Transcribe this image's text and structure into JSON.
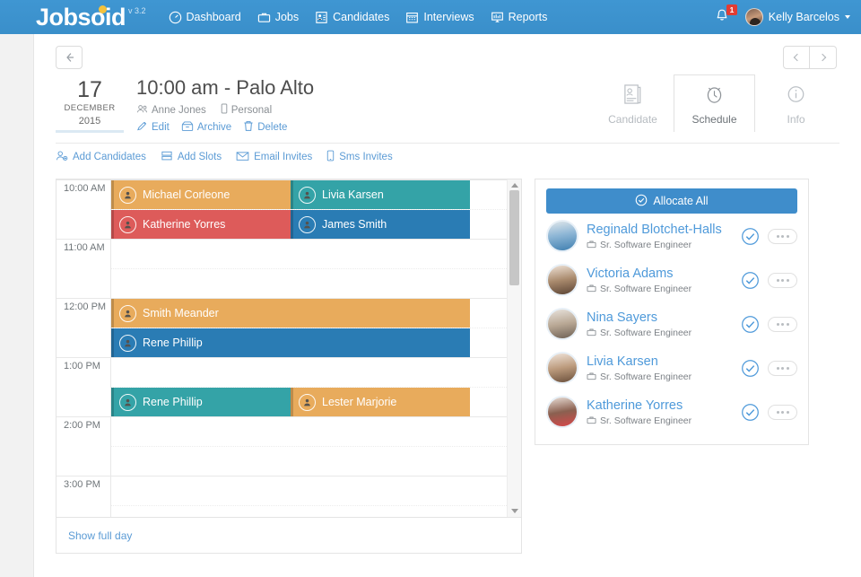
{
  "brand": {
    "name": "Jobsoid",
    "version": "v 3.2",
    "accent": "#3f8dcb",
    "logo_dot_color": "#f5c23c"
  },
  "topnav": {
    "items": [
      {
        "label": "Dashboard",
        "icon": "dashboard-gauge-icon"
      },
      {
        "label": "Jobs",
        "icon": "briefcase-icon"
      },
      {
        "label": "Candidates",
        "icon": "id-card-icon"
      },
      {
        "label": "Interviews",
        "icon": "calendar-icon"
      },
      {
        "label": "Reports",
        "icon": "bar-chart-icon"
      }
    ],
    "notifications": {
      "count": "1",
      "icon": "bell-icon",
      "badge_color": "#e23c33"
    },
    "user": {
      "name": "Kelly Barcelos",
      "icon": "avatar",
      "caret": "chevron-down-icon"
    }
  },
  "toolbar": {
    "back_icon": "arrow-left-icon",
    "prev_icon": "chevron-left-icon",
    "next_icon": "chevron-right-icon"
  },
  "event": {
    "date": {
      "day": "17",
      "month": "DECEMBER",
      "year": "2015"
    },
    "title": "10:00 am - Palo Alto",
    "meta": [
      {
        "label": "Anne Jones",
        "icon": "users-icon"
      },
      {
        "label": "Personal",
        "icon": "tag-icon"
      }
    ],
    "actions": [
      {
        "label": "Edit",
        "icon": "pencil-icon"
      },
      {
        "label": "Archive",
        "icon": "archive-box-icon"
      },
      {
        "label": "Delete",
        "icon": "trash-icon"
      }
    ],
    "tabs": [
      {
        "label": "Candidate",
        "icon": "id-card-icon",
        "active": false
      },
      {
        "label": "Schedule",
        "icon": "alarm-clock-icon",
        "active": true
      },
      {
        "label": "Info",
        "icon": "info-circle-icon",
        "active": false
      }
    ],
    "subactions": [
      {
        "label": "Add Candidates",
        "icon": "user-plus-icon"
      },
      {
        "label": "Add Slots",
        "icon": "slots-icon"
      },
      {
        "label": "Email Invites",
        "icon": "envelope-icon"
      },
      {
        "label": "Sms Invites",
        "icon": "phone-icon"
      }
    ]
  },
  "calendar": {
    "hours": [
      "10:00 AM",
      "11:00 AM",
      "12:00 PM",
      "1:00 PM",
      "2:00 PM",
      "3:00 PM"
    ],
    "events": [
      {
        "name": "Michael Corleone",
        "color": "orange",
        "row": 0,
        "half": 0,
        "col": "left",
        "icon": "person-badge-icon"
      },
      {
        "name": "Livia Karsen",
        "color": "teal",
        "row": 0,
        "half": 0,
        "col": "right",
        "icon": "person-badge-icon"
      },
      {
        "name": "Katherine Yorres",
        "color": "red",
        "row": 0,
        "half": 1,
        "col": "left",
        "icon": "person-badge-icon"
      },
      {
        "name": "James Smith",
        "color": "blue",
        "row": 0,
        "half": 1,
        "col": "right",
        "icon": "person-badge-icon"
      },
      {
        "name": "Smith Meander",
        "color": "orange",
        "row": 2,
        "half": 0,
        "col": "full",
        "icon": "person-badge-icon"
      },
      {
        "name": "Rene Phillip",
        "color": "blue",
        "row": 2,
        "half": 1,
        "col": "full",
        "icon": "person-badge-icon"
      },
      {
        "name": "Rene Phillip",
        "color": "teal",
        "row": 3,
        "half": 1,
        "col": "left",
        "icon": "person-badge-icon"
      },
      {
        "name": "Lester Marjorie",
        "color": "orange",
        "row": 3,
        "half": 1,
        "col": "right",
        "icon": "person-badge-icon"
      }
    ],
    "colors": {
      "orange": "#e8ab5c",
      "red": "#dd5b5a",
      "teal": "#34a3a7",
      "blue": "#2a7cb4"
    },
    "footer_link": "Show full day",
    "scrollbar": {
      "up_icon": "triangle-up-icon",
      "down_icon": "triangle-down-icon"
    }
  },
  "candidates_panel": {
    "allocate_all_label": "Allocate All",
    "allocate_all_icon": "check-circle-icon",
    "role_icon": "briefcase-icon",
    "check_icon": "check-circle-icon",
    "more_icon": "ellipsis-icon",
    "rows": [
      {
        "name": "Reginald Blotchet-Halls",
        "role": "Sr. Software Engineer"
      },
      {
        "name": "Victoria Adams",
        "role": "Sr. Software Engineer"
      },
      {
        "name": "Nina Sayers",
        "role": "Sr. Software Engineer"
      },
      {
        "name": "Livia Karsen",
        "role": "Sr. Software Engineer"
      },
      {
        "name": "Katherine Yorres",
        "role": "Sr. Software Engineer"
      }
    ]
  }
}
